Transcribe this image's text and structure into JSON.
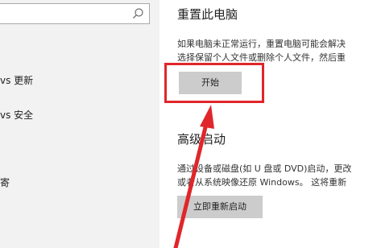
{
  "sidebar": {
    "search": {
      "placeholder": "",
      "value": ""
    },
    "items": [
      {
        "label": "vs 更新"
      },
      {
        "label": "vs 安全"
      },
      {
        "label": "寄"
      }
    ]
  },
  "main": {
    "reset": {
      "title": "重置此电脑",
      "desc_line1": "如果电脑未正常运行，重置电脑可能会解决",
      "desc_line2": "选择保留个人文件或删除个人文件，然后重",
      "button_label": "开始"
    },
    "advanced_startup": {
      "title": "高级启动",
      "desc_line1": "通过设备或磁盘(如 U 盘或 DVD)启动，更改",
      "desc_line2": "或者从系统映像还原 Windows。 这将重新",
      "button_label": "立即重新启动"
    }
  },
  "annotation": {
    "highlight_color": "#e0262a"
  }
}
